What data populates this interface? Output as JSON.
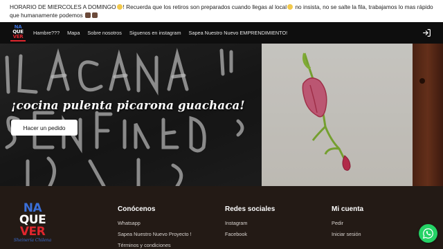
{
  "announcement": {
    "line1_a": "HORARIO DE MIERCOLES A DOMINGO",
    "line1_b": "! Recuerda que los retiros son preparados cuando llegas al local",
    "line1_c": " no insista, no se salte la fila, trabajamos lo mas rápido",
    "line2": "que humanamente podemos"
  },
  "brand": {
    "logo_line1": "NA",
    "logo_line2": "QUE",
    "logo_line3": "VER",
    "logo_sub": "Sheinería Chilena",
    "colors": {
      "blue": "#3a6fd8",
      "red": "#e0262d",
      "nav_bg": "#0e0e0e",
      "footer_bg": "#231a15"
    }
  },
  "nav": {
    "links": [
      "Hambre???",
      "Mapa",
      "Sobre nosotros",
      "Siguenos en instagram",
      "Sapea Nuestro Nuevo EMPRENDIMIENTO!"
    ],
    "login_icon": "login-icon"
  },
  "hero": {
    "tagline": "¡cocina pulenta picarona guachaca!",
    "cta": "Hacer un pedido"
  },
  "footer": {
    "col1": {
      "title": "Conócenos",
      "links": [
        "Whatsapp",
        "Sapea Nuestro Nuevo Proyecto !",
        "Términos y condiciones"
      ]
    },
    "col2": {
      "title": "Redes sociales",
      "links": [
        "Instagram",
        "Facebook"
      ]
    },
    "col3": {
      "title": "Mi cuenta",
      "links": [
        "Pedir",
        "Iniciar sesión"
      ]
    }
  },
  "whatsapp": {
    "icon": "whatsapp-icon",
    "color": "#25d366"
  }
}
